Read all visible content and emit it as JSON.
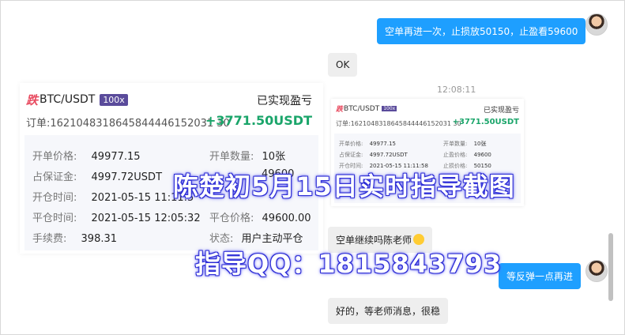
{
  "chat": {
    "msg1": "空单再进一次，止损放50150，止盈看59600",
    "msg2": "OK",
    "timestamp": "12:08:11",
    "msg3": "空单继续吗陈老师",
    "msg4": "等反弹一点再进",
    "msg5": "好的，等老师消息，很稳"
  },
  "card": {
    "badge": "跌",
    "pair": "BTC/USDT",
    "leverage": "100x",
    "realized_label": "已实现盈亏",
    "order_id": "订单:1621048318645844446152031 30",
    "order_id_full": "订单:16210483186458444446152031 30",
    "pnl": "+3771.50USDT",
    "open_price_label": "开单价格:",
    "open_price": "49977.15",
    "open_qty_label": "开单数量:",
    "open_qty": "10张",
    "margin_label": "占保证金:",
    "margin": "4997.72USDT",
    "open_time_label": "开仓时间:",
    "open_time": "2021-05-15 11:11:5",
    "close_time_label": "平仓时间:",
    "close_time": "2021-05-15 12:05:32",
    "close_price_label": "平仓价格:",
    "close_price": "49600.00",
    "fee_label": "手续费:",
    "fee": "398.31",
    "status_label": "状态:",
    "status": "用户主动平仓",
    "partial_value": "49600"
  },
  "small_card": {
    "badge": "跌",
    "pair": "BTC/USDT",
    "leverage": "100x",
    "realized_label": "已实现盈亏",
    "order_id": "订单:1621048318645844446152031 30",
    "pnl": "+3771.50USDT",
    "open_price_label": "开单价格:",
    "open_price": "49977.15",
    "open_qty_label": "开单数量:",
    "open_qty": "10张",
    "margin_label": "占保证金:",
    "margin": "4997.72USDT",
    "tp_label": "止盈价格:",
    "tp": "49600",
    "open_time_label": "开仓时间:",
    "open_time": "2021-05-15 11:11:58",
    "sl_label": "止损价格:",
    "sl": "50150"
  },
  "overlay": {
    "line1": "陈楚初5月15日实时指导截图",
    "line2": "指导QQ：1815843793"
  }
}
